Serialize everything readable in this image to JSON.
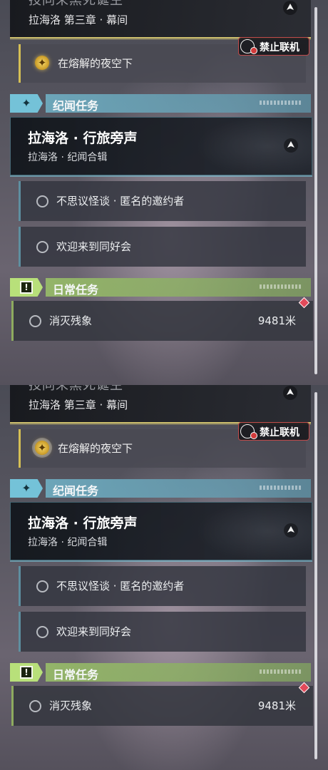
{
  "panels": [
    {
      "chapter": {
        "cut_title": "技同来黑死诞生",
        "subtitle": "拉海洛 第三章 · 幕间"
      },
      "current_quest": {
        "label": "在熔解的夜空下"
      },
      "no_online_badge": {
        "label": "禁止联机"
      },
      "story_section": {
        "title": "纪闻任务",
        "card_title": "拉海洛 · 行旅旁声",
        "card_subtitle": "拉海洛 · 纪闻合辑",
        "sub_quests": [
          "不思议怪谈 · 匿名的邀约者",
          "欢迎来到同好会"
        ]
      },
      "daily_section": {
        "title": "日常任务",
        "quest": "消灭残象",
        "distance": "9481米"
      }
    },
    {
      "chapter": {
        "cut_title": "技同来黑死诞生",
        "subtitle": "拉海洛 第三章 · 幕间"
      },
      "current_quest": {
        "label": "在熔解的夜空下"
      },
      "no_online_badge": {
        "label": "禁止联机"
      },
      "story_section": {
        "title": "纪闻任务",
        "card_title": "拉海洛 · 行旅旁声",
        "card_subtitle": "拉海洛 · 纪闻合辑",
        "sub_quests": [
          "不思议怪谈 · 匿名的邀约者",
          "欢迎来到同好会"
        ]
      },
      "daily_section": {
        "title": "日常任务",
        "quest": "消灭残象",
        "distance": "9481米"
      }
    }
  ],
  "icons": {
    "quest_marker": "navigation-arrow-icon",
    "current_quest": "compass-star-icon",
    "story": "four-point-star-icon",
    "daily": "exclamation-square-icon",
    "no_online": "globe-ban-icon",
    "daily_alert": "red-diamond-icon"
  },
  "colors": {
    "chapter_accent": "#cdbf6d",
    "story_accent": "#74c2d8",
    "daily_accent": "#b8e07a",
    "alert": "#e24a5a"
  }
}
